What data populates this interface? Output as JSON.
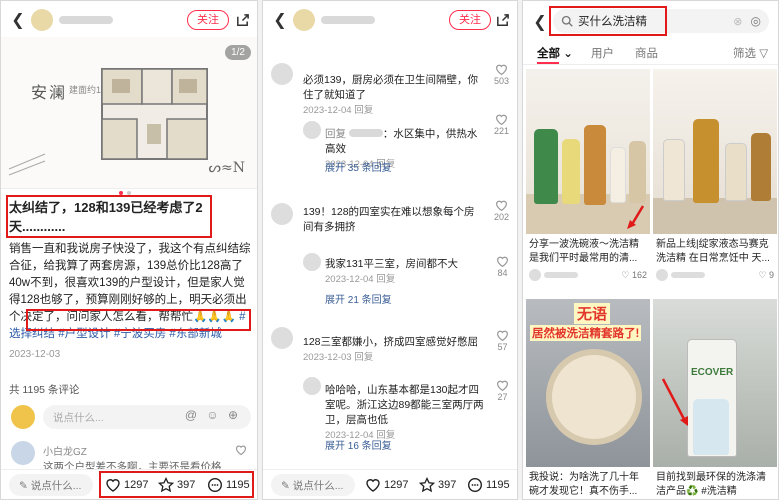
{
  "panel1": {
    "follow_label": "关注",
    "image_counter": "1/2",
    "floorplan_title": "安澜",
    "floorplan_sub": "建面约128㎡",
    "title": "太纠结了，128和139已经考虑了2天............",
    "body": "销售一直和我说房子快没了，我这个有点纠结综合征，给我算了两套房源，139总价比128高了40w不到，很喜欢139的户型设计，但是家人觉得128也够了，预算刚刚好够的上，明天必须出个决定了，问问家人怎么看，帮帮忙",
    "emoji": "🙏🙏🙏",
    "tags": [
      "#选择纠结",
      "#户型设计",
      "#宁波买房",
      "#东部新城"
    ],
    "date": "2023-12-03",
    "comment_count": "共 1195 条评论",
    "comment_placeholder": "说点什么...",
    "emoji_icons": "@ ☺ ⊕",
    "first_comment_name": "小白龙GZ",
    "first_comment_text": "这两个户型差不多啊，主要还是看价格",
    "first_comment_likes": "",
    "say_label": "说点什么...",
    "likes": "1297",
    "stars": "397",
    "comments": "1195"
  },
  "panel2": {
    "follow_label": "关注",
    "comments": [
      {
        "text": "必须139，厨房必须在卫生间隔壁，你住了就知道了",
        "meta": "2023-12-04 回复",
        "likes": "503"
      },
      {
        "text": "回复",
        "text2": "：水区集中，供热水高效",
        "meta": "2023-12-04 回复",
        "likes": "221",
        "expand": "展开 35 条回复"
      },
      {
        "text": "139！128的四室实在难以想象每个房间有多拥挤",
        "meta": "2023-12-04 回复",
        "likes": "202"
      },
      {
        "text": "我家131平三室，房间都不大",
        "meta": "2023-12-04 回复",
        "likes": "84",
        "expand": "展开 21 条回复"
      },
      {
        "text": "128三室都嫌小，挤成四室感觉好憋屈",
        "meta": "2023-12-03 回复",
        "likes": "57"
      },
      {
        "text": "哈哈哈，山东基本都是130起才四室呢。浙江这边89都能三室两厅两卫，层高也低",
        "meta": "2023-12-04 回复",
        "likes": "27",
        "expand": "展开 16 条回复"
      }
    ],
    "say_label": "说点什么...",
    "likes": "1297",
    "stars": "397",
    "comments_count": "1195"
  },
  "panel3": {
    "search_text": "买什么洗洁精",
    "tabs": [
      "全部",
      "用户",
      "商品"
    ],
    "filter_label": "筛选",
    "cards": [
      {
        "title": "分享一波洗碗液～洗洁精是我们平时最常用的清...",
        "likes": "162"
      },
      {
        "title": "新品上线|绽家液态马赛克洗洁精 在日常烹饪中 天...",
        "likes": "9"
      },
      {
        "title": "我投说：为啥洗了几十年碗才发现它！真不伤手...",
        "likes": "",
        "overlay": "无语",
        "overlay2": "居然被洗洁精套路了!"
      },
      {
        "title": "目前找到最环保的洗涤清洁产品♻️ #洗洁精 ECOVER",
        "likes": "",
        "brand": "ECOVER"
      }
    ]
  },
  "colors": {
    "accent": "#ff2e4d",
    "annotation": "#e01919",
    "tag": "#2d5ba6"
  }
}
